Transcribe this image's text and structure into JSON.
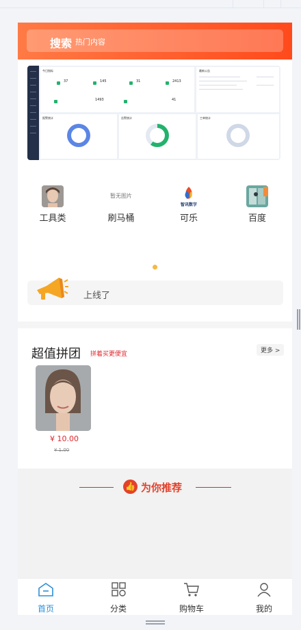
{
  "search": {
    "main_label": "搜索",
    "sub_label": "热门内容"
  },
  "dashboard": {
    "card_titles": [
      "今日指标",
      "最新公告",
      "报警统计",
      "告警统计",
      "工单统计"
    ],
    "stats": [
      "37",
      "145",
      "31",
      "2413"
    ],
    "row2_stats": [
      "1493",
      "41"
    ],
    "colors": {
      "blue": "#5b86e5",
      "green": "#23b26d"
    }
  },
  "nav": {
    "items": [
      {
        "label": "工具类",
        "icon": "portrait-photo"
      },
      {
        "label": "刷马桶",
        "icon": "placeholder-image",
        "placeholder_text": "暂无图片"
      },
      {
        "label": "可乐",
        "icon": "flame-logo",
        "logo_text": "智讯数字"
      },
      {
        "label": "百度",
        "icon": "elevator-photo"
      }
    ]
  },
  "notice": {
    "text": "上线了"
  },
  "group": {
    "title": "超值拼团",
    "subtitle": "拼着买更便宜",
    "more": "更多 >",
    "product": {
      "price": "¥ 10.00",
      "old_price": "¥ 1.00"
    }
  },
  "recommend": {
    "title": "为你推荐"
  },
  "tabbar": {
    "items": [
      {
        "label": "首页",
        "active": true
      },
      {
        "label": "分类",
        "active": false
      },
      {
        "label": "购物车",
        "active": false
      },
      {
        "label": "我的",
        "active": false
      }
    ]
  },
  "colors": {
    "brand_orange": "#ff5a26",
    "accent_red": "#e0262c",
    "tab_active": "#2b8fd8"
  }
}
